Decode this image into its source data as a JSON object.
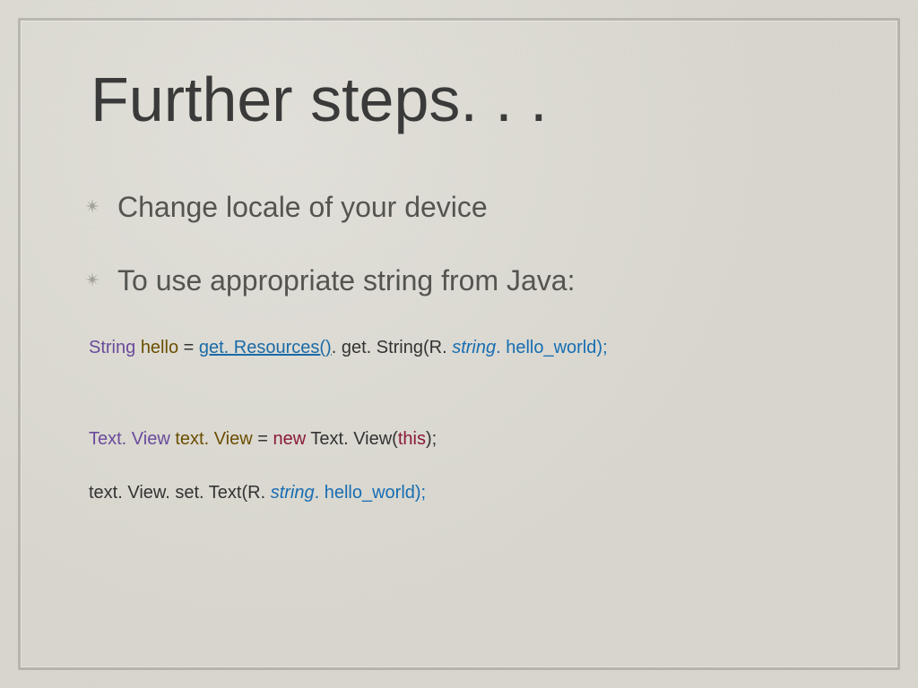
{
  "title": "Further steps. . .",
  "bullets": [
    "Change locale of your device",
    "To use appropriate string from Java:"
  ],
  "code1": {
    "t_string": "String ",
    "v_hello": "hello ",
    "eq": "= ",
    "link": "get. Resources()",
    "after": ". get. String(R. ",
    "field": "string",
    "tail": ". hello_world);"
  },
  "code2": {
    "t_tv": "Text. View ",
    "v_tv": "text. View ",
    "eq": "= ",
    "kw_new": "new",
    "ctor": " Text. View(",
    "this": "this",
    "close": ");"
  },
  "code3": {
    "pre": "text. View. set. Text(R. ",
    "field": "string",
    "tail": ". hello_world);"
  }
}
